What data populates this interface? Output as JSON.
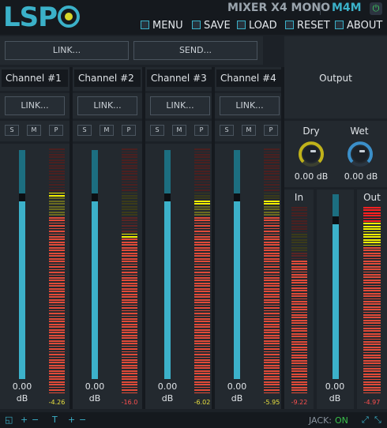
{
  "header": {
    "logo": "LSP",
    "title": "MIXER X4 MONO",
    "code": "M4M",
    "menu": [
      {
        "label": "MENU",
        "icon": "menu-icon"
      },
      {
        "label": "SAVE",
        "icon": "save-icon"
      },
      {
        "label": "LOAD",
        "icon": "load-icon"
      },
      {
        "label": "RESET",
        "icon": "reset-icon"
      },
      {
        "label": "ABOUT",
        "icon": "about-icon"
      }
    ]
  },
  "top_buttons": {
    "link": "LINK...",
    "send": "SEND..."
  },
  "channels": [
    {
      "name": "Channel #1",
      "link": "LINK...",
      "s": "S",
      "m": "M",
      "p": "P",
      "gain": "0.00",
      "unit": "dB",
      "peak": "-4.26",
      "fader": 0.81,
      "level": 0.82
    },
    {
      "name": "Channel #2",
      "link": "LINK...",
      "s": "S",
      "m": "M",
      "p": "P",
      "gain": "0.00",
      "unit": "dB",
      "peak": "-16.0",
      "fader": 0.81,
      "level": 0.66
    },
    {
      "name": "Channel #3",
      "link": "LINK...",
      "s": "S",
      "m": "M",
      "p": "P",
      "gain": "0.00",
      "unit": "dB",
      "peak": "-6.02",
      "fader": 0.81,
      "level": 0.79
    },
    {
      "name": "Channel #4",
      "link": "LINK...",
      "s": "S",
      "m": "M",
      "p": "P",
      "gain": "0.00",
      "unit": "dB",
      "peak": "-5.95",
      "fader": 0.81,
      "level": 0.79
    }
  ],
  "output": {
    "title": "Output",
    "dry": {
      "label": "Dry",
      "value": "0.00 dB"
    },
    "wet": {
      "label": "Wet",
      "value": "0.00 dB"
    },
    "in_label": "In",
    "in_peak": "-9.22",
    "out_label": "Out",
    "out_peak": "-4.97",
    "gain": "0.00",
    "unit": "dB"
  },
  "footer": {
    "jack_label": "JACK:",
    "jack_status": "ON"
  },
  "colors": {
    "accent": "#3bb1c9",
    "meter_yellow": "#f4f000",
    "meter_red": "#e24c3c"
  }
}
